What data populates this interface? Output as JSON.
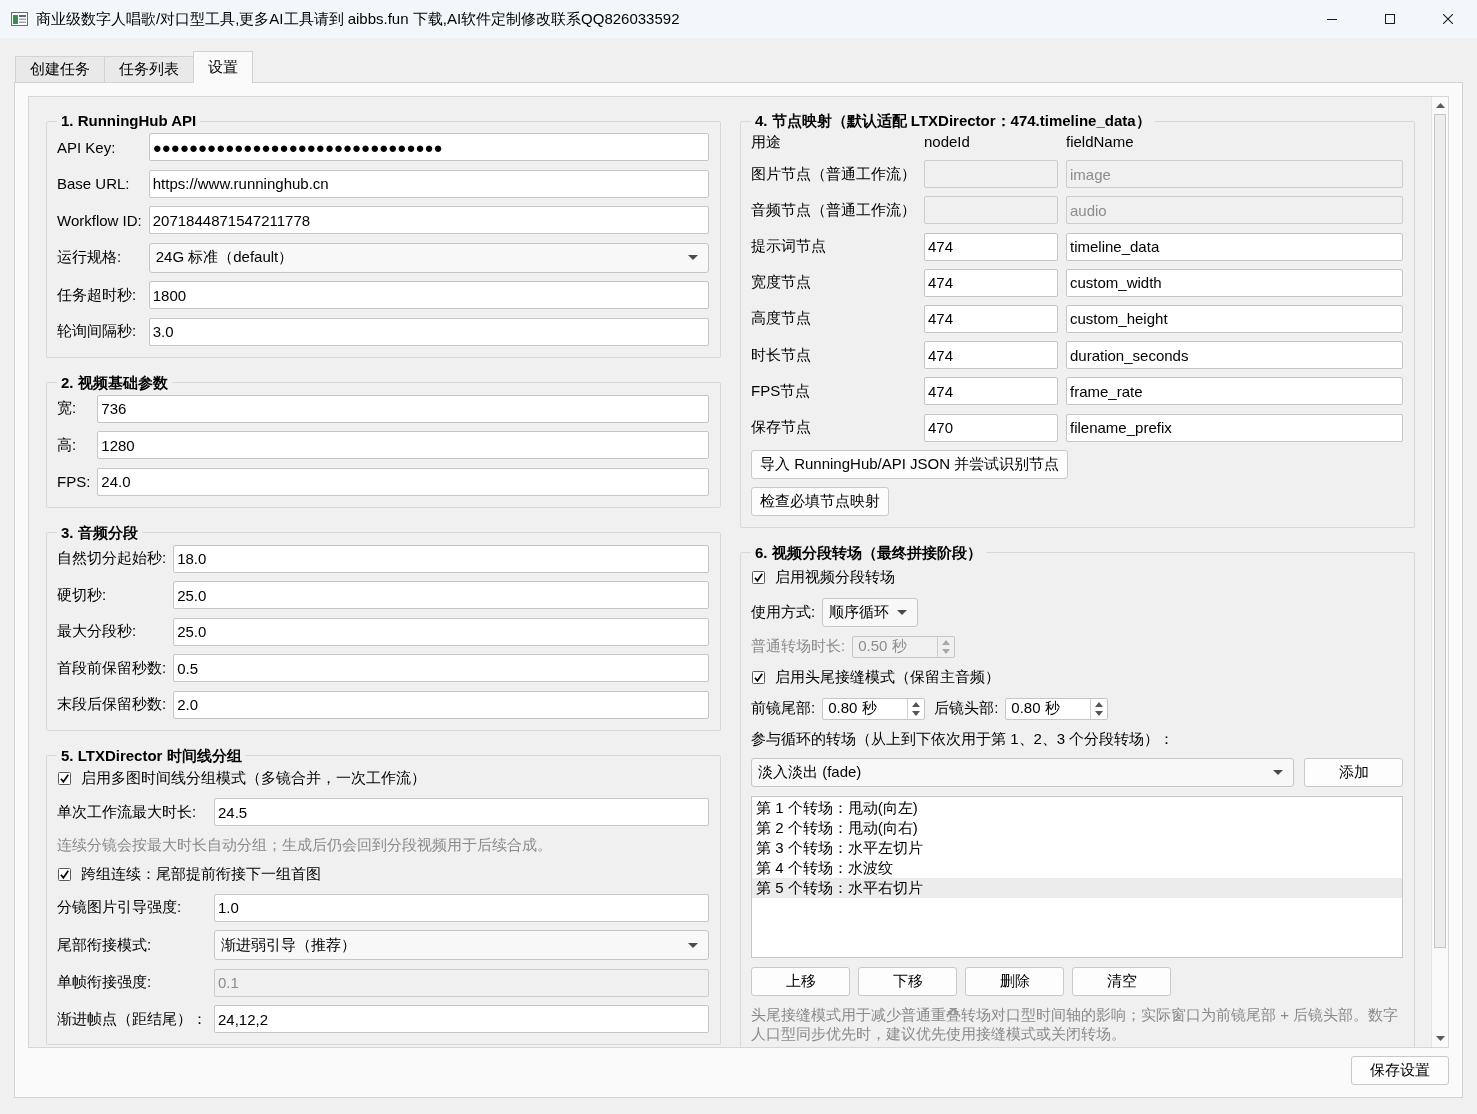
{
  "window": {
    "title": "商业级数字人唱歌/对口型工具,更多AI工具请到 aibbs.fun 下载,AI软件定制修改联系QQ826033592"
  },
  "tabs": [
    {
      "label": "创建任务",
      "selected": false
    },
    {
      "label": "任务列表",
      "selected": false
    },
    {
      "label": "设置",
      "selected": true
    }
  ],
  "left_column": [
    {
      "kind": "form",
      "title": "1. RunningHub API",
      "rows": [
        {
          "kind": "field",
          "label": "API Key:",
          "value": "●●●●●●●●●●●●●●●●●●●●●●●●●●●●●●●●",
          "disabled": false
        },
        {
          "kind": "field",
          "label": "Base URL:",
          "value": "https://www.runninghub.cn",
          "disabled": false
        },
        {
          "kind": "field",
          "label": "Workflow ID:",
          "value": "2071844871547211778",
          "disabled": false
        },
        {
          "kind": "combo",
          "label": "运行规格:",
          "value": "24G 标准（default）",
          "disabled": false
        },
        {
          "kind": "field",
          "label": "任务超时秒:",
          "value": "1800",
          "disabled": false
        },
        {
          "kind": "field",
          "label": "轮询间隔秒:",
          "value": "3.0",
          "disabled": false
        }
      ]
    },
    {
      "kind": "form",
      "title": "2. 视频基础参数",
      "rows": [
        {
          "kind": "field",
          "label": "宽:",
          "value": "736",
          "disabled": false
        },
        {
          "kind": "field",
          "label": "高:",
          "value": "1280",
          "disabled": false
        },
        {
          "kind": "field",
          "label": "FPS:",
          "value": "24.0",
          "disabled": false
        }
      ]
    },
    {
      "kind": "form",
      "title": "3. 音频分段",
      "rows": [
        {
          "kind": "field",
          "label": "自然切分起始秒:",
          "value": "18.0",
          "disabled": false
        },
        {
          "kind": "field",
          "label": "硬切秒:",
          "value": "25.0",
          "disabled": false
        },
        {
          "kind": "field",
          "label": "最大分段秒:",
          "value": "25.0",
          "disabled": false
        },
        {
          "kind": "field",
          "label": "首段前保留秒数:",
          "value": "0.5",
          "disabled": false
        },
        {
          "kind": "field",
          "label": "末段后保留秒数:",
          "value": "2.0",
          "disabled": false
        }
      ]
    },
    {
      "kind": "form",
      "title": "5. LTXDirector 时间线分组",
      "rows": [
        {
          "kind": "checkbox",
          "label": "启用多图时间线分组模式（多镜合并，一次工作流）",
          "checked": true
        },
        {
          "kind": "field",
          "label": "单次工作流最大时长:",
          "value": "24.5",
          "disabled": false
        },
        {
          "kind": "hint",
          "text": "连续分镜会按最大时长自动分组；生成后仍会回到分段视频用于后续合成。"
        },
        {
          "kind": "checkbox",
          "label": "跨组连续：尾部提前衔接下一组首图",
          "checked": true
        },
        {
          "kind": "field",
          "label": "分镜图片引导强度:",
          "value": "1.0",
          "disabled": false
        },
        {
          "kind": "combo",
          "label": "尾部衔接模式:",
          "value": "渐进弱引导（推荐）",
          "disabled": false
        },
        {
          "kind": "field",
          "label": "单帧衔接强度:",
          "value": "0.1",
          "disabled": true
        },
        {
          "kind": "field",
          "label": "渐进帧点（距结尾）：",
          "value": "24,12,2",
          "disabled": false
        }
      ]
    }
  ],
  "right_column": [
    {
      "kind": "mapping",
      "title": "4. 节点映射（默认适配 LTXDirector：474.timeline_data）",
      "rows": [
        {
          "kind": "header",
          "cells": [
            "用途",
            "nodeId",
            "fieldName"
          ]
        },
        {
          "kind": "mapping",
          "label": "图片节点（普通工作流）",
          "field_name": "image",
          "disabled": true
        },
        {
          "kind": "mapping",
          "label": "音频节点（普通工作流）",
          "field_name": "audio",
          "disabled": true
        },
        {
          "kind": "mapping",
          "label": "提示词节点",
          "node_id": "474",
          "field_name": "timeline_data",
          "disabled": false
        },
        {
          "kind": "mapping",
          "label": "宽度节点",
          "node_id": "474",
          "field_name": "custom_width",
          "disabled": false
        },
        {
          "kind": "mapping",
          "label": "高度节点",
          "node_id": "474",
          "field_name": "custom_height",
          "disabled": false
        },
        {
          "kind": "mapping",
          "label": "时长节点",
          "node_id": "474",
          "field_name": "duration_seconds",
          "disabled": false
        },
        {
          "kind": "mapping",
          "label": "FPS节点",
          "node_id": "474",
          "field_name": "frame_rate",
          "disabled": false
        },
        {
          "kind": "mapping",
          "label": "保存节点",
          "node_id": "470",
          "field_name": "filename_prefix",
          "disabled": false
        },
        {
          "kind": "button",
          "label": "导入 RunningHub/API JSON 并尝试识别节点"
        },
        {
          "kind": "button",
          "label": "检查必填节点映射"
        }
      ]
    },
    {
      "kind": "stack",
      "title": "6. 视频分段转场（最终拼接阶段）",
      "rows": [
        {
          "kind": "checkbox",
          "label": "启用视频分段转场",
          "checked": true
        },
        {
          "kind": "combo_inline",
          "label": "使用方式:",
          "value": "顺序循环"
        },
        {
          "kind": "spin",
          "label": "普通转场时长:",
          "value": "0.50 秒",
          "disabled": true
        },
        {
          "kind": "checkbox",
          "label": "启用头尾接缝模式（保留主音频）",
          "checked": true
        },
        {
          "kind": "spin_pair",
          "items": [
            {
              "label": "前镜尾部:",
              "value": "0.80 秒",
              "disabled": false
            },
            {
              "label": "后镜头部:",
              "value": "0.80 秒",
              "disabled": false
            }
          ]
        },
        {
          "kind": "text",
          "text": "参与循环的转场（从上到下依次用于第 1、2、3 个分段转场）："
        },
        {
          "kind": "combo_add",
          "value": "淡入淡出 (fade)",
          "button": "添加"
        },
        {
          "kind": "list",
          "items": [
            {
              "text": "第 1 个转场：甩动(向左)",
              "selected": false
            },
            {
              "text": "第 2 个转场：甩动(向右)",
              "selected": false
            },
            {
              "text": "第 3 个转场：水平左切片",
              "selected": false
            },
            {
              "text": "第 4 个转场：水波纹",
              "selected": false
            },
            {
              "text": "第 5 个转场：水平右切片",
              "selected": true
            }
          ]
        },
        {
          "kind": "buttons",
          "labels": [
            "上移",
            "下移",
            "删除",
            "清空"
          ]
        },
        {
          "kind": "hint",
          "text": "头尾接缝模式用于减少普通重叠转场对口型时间轴的影响；实际窗口为前镜尾部 + 后镜头部。数字人口型同步优先时，建议优先使用接缝模式或关闭转场。"
        }
      ]
    }
  ],
  "save_button": "保存设置"
}
